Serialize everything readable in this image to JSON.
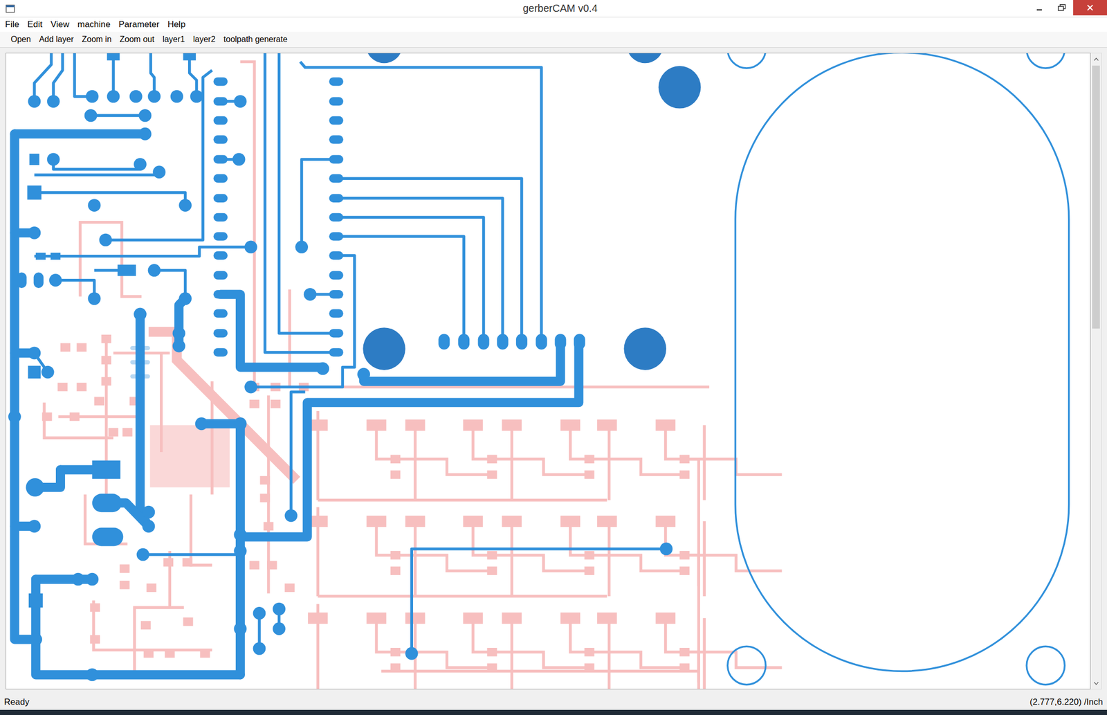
{
  "window": {
    "title": "gerberCAM v0.4"
  },
  "menu": [
    "File",
    "Edit",
    "View",
    "machine",
    "Parameter",
    "Help"
  ],
  "toolbar": [
    "Open",
    "Add layer",
    "Zoom in",
    "Zoom out",
    "layer1",
    "layer2",
    "toolpath generate"
  ],
  "canvas": {
    "layers": [
      {
        "color": "#3090db"
      },
      {
        "color": "#f08080"
      }
    ]
  },
  "scrollbar": {
    "level": 0.43
  },
  "status_bar": {
    "message": "Ready",
    "coordinates": "(2.777,6.220) /Inch"
  }
}
